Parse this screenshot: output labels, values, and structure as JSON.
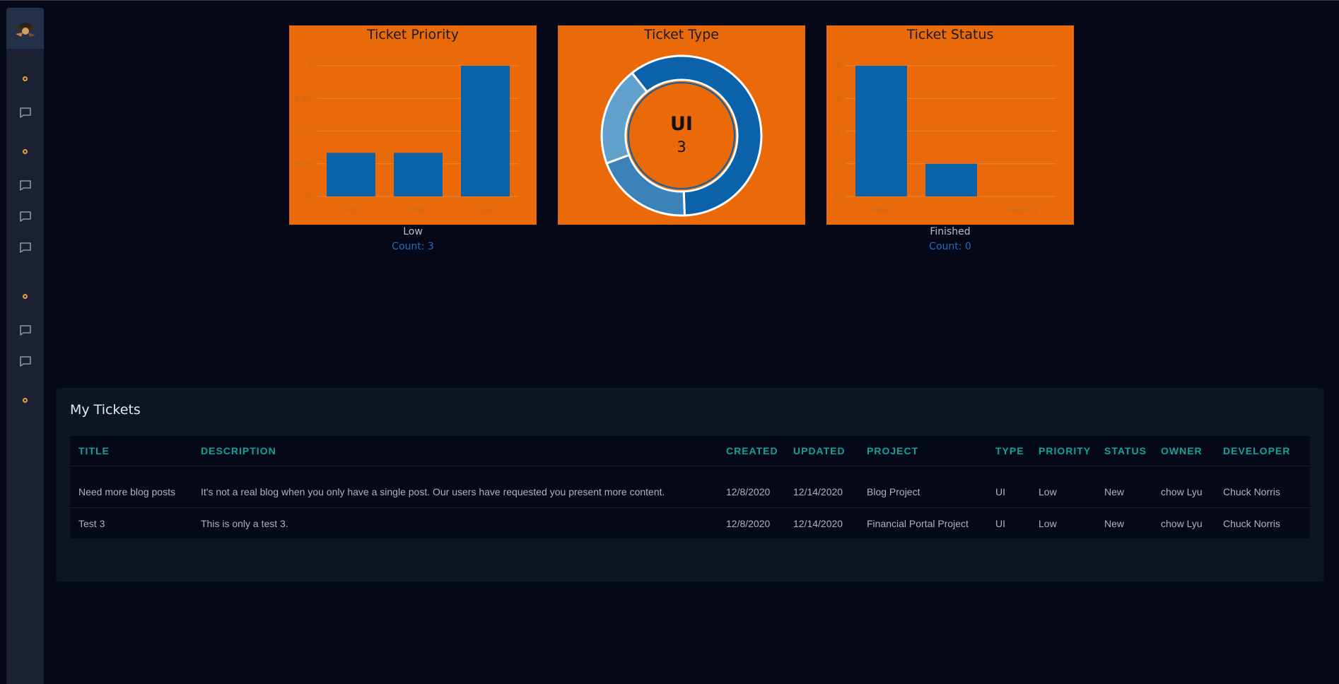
{
  "icons": {
    "logo": "pirate-logo-icon",
    "dot": "circle-dot-icon",
    "chat": "chat-bubble-icon"
  },
  "sidebar": {
    "items": [
      {
        "icon": "circle-dot-icon"
      },
      {
        "icon": "chat-bubble-icon"
      },
      {
        "icon": "circle-dot-icon"
      },
      {
        "icon": "chat-bubble-icon"
      },
      {
        "icon": "chat-bubble-icon"
      },
      {
        "icon": "chat-bubble-icon"
      },
      {
        "icon": "circle-dot-icon"
      },
      {
        "icon": "chat-bubble-icon"
      },
      {
        "icon": "chat-bubble-icon"
      },
      {
        "icon": "circle-dot-icon"
      }
    ]
  },
  "colors": {
    "chart_bg": "#ea6a0a",
    "bar": "#0b62a8",
    "accent_teal": "#12a39a",
    "count_blue": "#1f6fc2"
  },
  "charts": {
    "priority": {
      "title": "Ticket Priority",
      "caption": "Low",
      "count": "Count: 3"
    },
    "type": {
      "title": "Ticket Type",
      "center_label": "UI",
      "center_value": "3"
    },
    "status": {
      "title": "Ticket Status",
      "caption": "Finished",
      "count": "Count: 0"
    }
  },
  "chart_data": [
    {
      "type": "bar",
      "title": "Ticket Priority",
      "categories": [
        "High",
        "Mid",
        "Low"
      ],
      "values": [
        1,
        1,
        3
      ],
      "ylim": [
        0,
        3
      ],
      "yticks": [
        "0",
        "0.75",
        "1.5",
        "2.25",
        "3"
      ],
      "grid": true
    },
    {
      "type": "pie",
      "title": "Ticket Type",
      "labels": [
        "UI",
        "",
        ""
      ],
      "values": [
        3,
        1,
        1
      ],
      "center_text": "UI",
      "center_value": "3"
    },
    {
      "type": "bar",
      "title": "Ticket Status",
      "categories": [
        "New",
        "",
        "Finished"
      ],
      "values": [
        4,
        1,
        0
      ],
      "ylim": [
        0,
        4
      ],
      "yticks": [
        "0",
        "1",
        "2",
        "3",
        "4"
      ],
      "grid": true
    }
  ],
  "tickets": {
    "title": "My Tickets",
    "columns": [
      "TITLE",
      "DESCRIPTION",
      "CREATED",
      "UPDATED",
      "PROJECT",
      "TYPE",
      "PRIORITY",
      "STATUS",
      "OWNER",
      "DEVELOPER"
    ],
    "rows": [
      {
        "title": "Need more blog posts",
        "description": "It's not a real blog when you only have a single post. Our users have requested you present more content.",
        "created": "12/8/2020",
        "updated": "12/14/2020",
        "project": "Blog Project",
        "type": "UI",
        "priority": "Low",
        "status": "New",
        "owner": "chow Lyu",
        "developer": "Chuck Norris"
      },
      {
        "title": "Test 3",
        "description": "This is only a test 3.",
        "created": "12/8/2020",
        "updated": "12/14/2020",
        "project": "Financial Portal Project",
        "type": "UI",
        "priority": "Low",
        "status": "New",
        "owner": "chow Lyu",
        "developer": "Chuck Norris"
      }
    ]
  }
}
